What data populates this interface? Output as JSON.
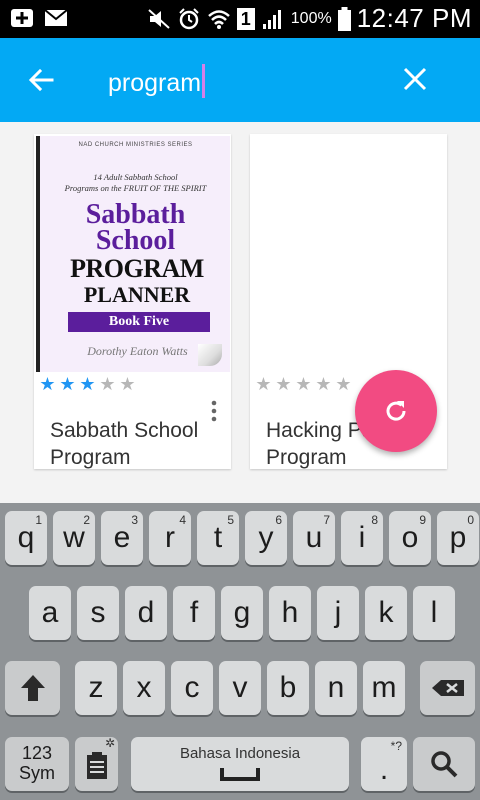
{
  "status_bar": {
    "battery_percent": "100%",
    "time": "12:47 PM",
    "sim_badge": "1",
    "icons": [
      "add-box-icon",
      "email-icon",
      "mute-icon",
      "alarm-icon",
      "wifi-icon",
      "sim-icon",
      "signal-icon",
      "battery-icon"
    ]
  },
  "search_bar": {
    "query": "program",
    "back_icon": "arrow-left-icon",
    "clear_icon": "close-icon",
    "background": "#03a9f4"
  },
  "results": [
    {
      "title": "Sabbath School Program",
      "rating": 3,
      "max_rating": 5,
      "cover": {
        "series": "NAD CHURCH MINISTRIES SERIES",
        "subtitle_1": "14 Adult Sabbath School",
        "subtitle_2": "Programs on the FRUIT OF THE SPIRIT",
        "line_1": "Sabbath",
        "line_2": "School",
        "line_3": "PROGRAM",
        "line_4": "PLANNER",
        "book": "Book Five",
        "author": "Dorothy Eaton Watts"
      }
    },
    {
      "title": "Hacking Pakai Program",
      "rating": 0,
      "max_rating": 5
    }
  ],
  "fab": {
    "icon": "refresh-icon",
    "color": "#f24b82"
  },
  "keyboard": {
    "row1": [
      {
        "k": "q",
        "h": "1"
      },
      {
        "k": "w",
        "h": "2"
      },
      {
        "k": "e",
        "h": "3"
      },
      {
        "k": "r",
        "h": "4"
      },
      {
        "k": "t",
        "h": "5"
      },
      {
        "k": "y",
        "h": "6"
      },
      {
        "k": "u",
        "h": "7"
      },
      {
        "k": "i",
        "h": "8"
      },
      {
        "k": "o",
        "h": "9"
      },
      {
        "k": "p",
        "h": "0"
      }
    ],
    "row2": [
      "a",
      "s",
      "d",
      "f",
      "g",
      "h",
      "j",
      "k",
      "l"
    ],
    "row3": [
      "z",
      "x",
      "c",
      "v",
      "b",
      "n",
      "m"
    ],
    "sym_key": "123\nSym",
    "space_label": "Bahasa Indonesia",
    "period_key": ".",
    "period_hint": "*?"
  }
}
